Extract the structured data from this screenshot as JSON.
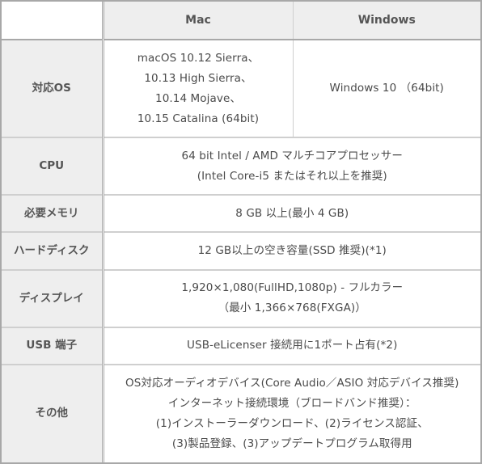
{
  "table": {
    "headers": {
      "corner": "",
      "mac": "Mac",
      "windows": "Windows"
    },
    "rows": [
      {
        "label": "対応OS",
        "mac_lines": [
          "macOS 10.12 Sierra、",
          "10.13 High Sierra、",
          "10.14 Mojave、",
          "10.15 Catalina (64bit)"
        ],
        "windows_lines": [
          "Windows 10 （64bit)"
        ]
      },
      {
        "label": "CPU",
        "lines": [
          "64 bit Intel / AMD マルチコアプロセッサー",
          "(Intel Core-i5 またはそれ以上を推奨)"
        ]
      },
      {
        "label": "必要メモリ",
        "lines": [
          "8 GB 以上(最小  4 GB)"
        ]
      },
      {
        "label": "ハードディスク",
        "lines": [
          "12 GB以上の空き容量(SSD 推奨)(*1)"
        ]
      },
      {
        "label": "ディスプレイ",
        "lines": [
          "1,920×1,080(FullHD,1080p) - フルカラー",
          "（最小 1,366×768(FXGA)）"
        ]
      },
      {
        "label": "USB 端子",
        "lines": [
          "USB-eLicenser 接続用に1ポート占有(*2)"
        ]
      },
      {
        "label": "その他",
        "lines": [
          "OS対応オーディオデバイス(Core Audio／ASIO 対応デバイス推奨)",
          "インターネット接続環境（ブロードバンド推奨）：",
          "(1)インストーラーダウンロード、(2)ライセンス認証、",
          "(3)製品登録、(3)アップデートプログラム取得用"
        ]
      }
    ]
  }
}
